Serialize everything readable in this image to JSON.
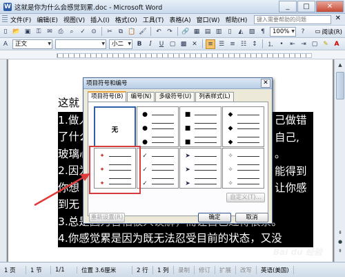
{
  "window": {
    "title": "这就是你为什么会感觉到累.doc - Microsoft Word",
    "minimize": "_",
    "maximize": "□",
    "close": "✕"
  },
  "menu": {
    "items": [
      "文件(F)",
      "编辑(E)",
      "视图(V)",
      "插入(I)",
      "格式(O)",
      "工具(T)",
      "表格(A)",
      "窗口(W)",
      "帮助(H)"
    ],
    "ask_placeholder": "键入需要帮助的问题",
    "close_doc": "✕"
  },
  "toolbar1": {
    "zoom": "100%",
    "read_label": "阅读(R)"
  },
  "toolbar2": {
    "style": "正文",
    "font": "",
    "size": "小二",
    "bold": "B",
    "italic": "I",
    "underline": "U",
    "font_color": "A"
  },
  "document": {
    "lines": [
      {
        "text": "这就",
        "selected": false
      },
      {
        "text": "1.做人",
        "selected": true
      },
      {
        "text": "了什么",
        "selected": true
      },
      {
        "text": "玻璃心",
        "selected": true
      },
      {
        "text": "2.因为",
        "selected": true
      },
      {
        "text": "你想",
        "selected": true
      },
      {
        "text": "到无",
        "selected": true
      },
      {
        "text": "3.总是因为害怕被人误解，而让自己过得很累。",
        "selected": true
      },
      {
        "text": "4.你感觉累是因为既无法忍受目前的状态，又没",
        "selected": true
      }
    ],
    "right_fragments": [
      "己做错",
      "自己,",
      "。",
      "能得到",
      "让你感"
    ]
  },
  "dialog": {
    "title": "项目符号和编号",
    "close": "✕",
    "tabs": [
      "项目符号(B)",
      "编号(N)",
      "多级符号(U)",
      "列表样式(L)"
    ],
    "none_label": "无",
    "bullets": [
      "",
      "●",
      "■",
      "◆",
      "✦",
      "✓",
      "➤",
      "✧"
    ],
    "buttons": {
      "customize": "自定义(T)...",
      "reset": "重新设置(R)",
      "ok": "确定",
      "cancel": "取消"
    }
  },
  "statusbar": {
    "page": "1 页",
    "section": "1 节",
    "page_of": "1/1",
    "position": "位置 3.6厘米",
    "line": "2 行",
    "column": "1 列",
    "rec": "录制",
    "trk": "修订",
    "ext": "扩展",
    "ovr": "改写",
    "lang": "英语(美国)"
  },
  "watermark": "Bai du 经验"
}
